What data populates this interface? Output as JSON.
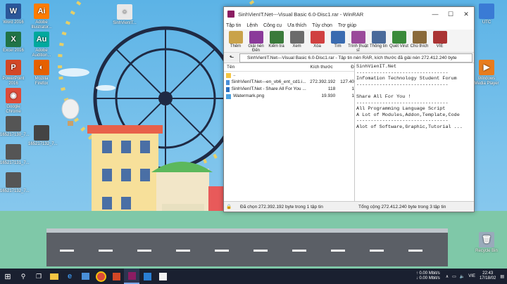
{
  "desktop": {
    "left_icons": [
      {
        "label": "Word 2016",
        "glyph": "W",
        "color": "#2b579a"
      },
      {
        "label": "Excel 2016",
        "glyph": "X",
        "color": "#217346"
      },
      {
        "label": "PowerPoint 2016",
        "glyph": "P",
        "color": "#d24726"
      },
      {
        "label": "Google Chrome",
        "glyph": "◉",
        "color": "#dd4b39"
      },
      {
        "label": "165217130_7...",
        "glyph": "",
        "color": "#555"
      },
      {
        "label": "165217131_7...",
        "glyph": "",
        "color": "#555"
      },
      {
        "label": "165217132_7...",
        "glyph": "",
        "color": "#555"
      }
    ],
    "second_icons": [
      {
        "label": "Adobe Illustrator...",
        "glyph": "Ai",
        "color": "#ff7c00"
      },
      {
        "label": "Adobe Audition...",
        "glyph": "Au",
        "color": "#00a99d"
      },
      {
        "label": "Mozilla Firefox",
        "glyph": "◐",
        "color": "#e66000"
      },
      {
        "label": "165217132_7...",
        "glyph": "",
        "color": "#444"
      }
    ],
    "top_icon": {
      "label": "SinhVienIT...",
      "glyph": "○"
    },
    "right_icons": [
      {
        "label": "UTC",
        "glyph": "",
        "color": "#3a7bd5"
      },
      {
        "label": "Windows Media Player",
        "glyph": "▶",
        "color": "#e87c1e"
      },
      {
        "label": "Recycle Bin",
        "glyph": "🗑",
        "color": "#9ab"
      }
    ],
    "dash_positions_count": 10
  },
  "window": {
    "title": "SinhVienIT.Net---Visual Basic 6.0-Disc1.rar - WinRAR",
    "controls": {
      "minimize": "—",
      "maximize": "☐",
      "close": "✕"
    },
    "menu": [
      "Tập tin",
      "Lệnh",
      "Công cụ",
      "Ưa thích",
      "Tùy chọn",
      "Trợ giúp"
    ],
    "toolbar": [
      {
        "label": "Thêm",
        "color": "#c9a24a"
      },
      {
        "label": "Giải nén Đến",
        "color": "#8b3a9a"
      },
      {
        "label": "Kiểm tra",
        "color": "#3a7a3a"
      },
      {
        "label": "Xem",
        "color": "#6b6b6b"
      },
      {
        "label": "Xóa",
        "color": "#d04040"
      },
      {
        "label": "Tìm",
        "color": "#3a6bb0"
      },
      {
        "label": "Trình thuật sĩ",
        "color": "#9a4a9a"
      },
      {
        "label": "Thông tin",
        "color": "#4a6a9a"
      },
      {
        "label": "Quét Virut",
        "color": "#3a8a3a"
      },
      {
        "label": "Chú thích",
        "color": "#8a6a3a"
      },
      {
        "label": "VIE",
        "color": "#aa3333"
      }
    ],
    "address": "SinhVienIT.Net---Visual Basic 6.0-Disc1.rar - Tập tin nén RAR, kích thước đã giải nén 272.412.240 byte",
    "columns": {
      "name": "Tên",
      "size": "Kích thước",
      "packed": "Đ"
    },
    "files": [
      {
        "name": "..",
        "size": "",
        "packed": "",
        "icon": "folder"
      },
      {
        "name": "SinhVienIT.Net---en_vb6_ent_cd1.i...",
        "size": "272.392.192",
        "packed": "127.40",
        "icon": "disc"
      },
      {
        "name": "SinhVienIT.Net - Share All For You ...",
        "size": "118",
        "packed": "1",
        "icon": "web"
      },
      {
        "name": "Watermark.png",
        "size": "19.930",
        "packed": "1",
        "icon": "image"
      }
    ],
    "comment": "SinhVienIT.Net\n--------------------------------\nInfomation Technology Student Forum\n--------------------------------\n\nShare All For You !\n--------------------------------\nAll Programming Language Script\nA Lot of Modules,Addon,Template,Code\n--------------------------------\nAlot of Software,Graphic,Tutorial ...",
    "status_left": "Đã chọn 272.392.192 byte trong 1 tập tin",
    "status_right": "Tổng cộng 272.412.240 byte trong 3 tập tin"
  },
  "taskbar": {
    "net_up": "0.00 Mbit/s",
    "net_down": "0.00 Mbit/s",
    "lang": "VIE",
    "time": "22:43",
    "date": "17/18/02"
  }
}
